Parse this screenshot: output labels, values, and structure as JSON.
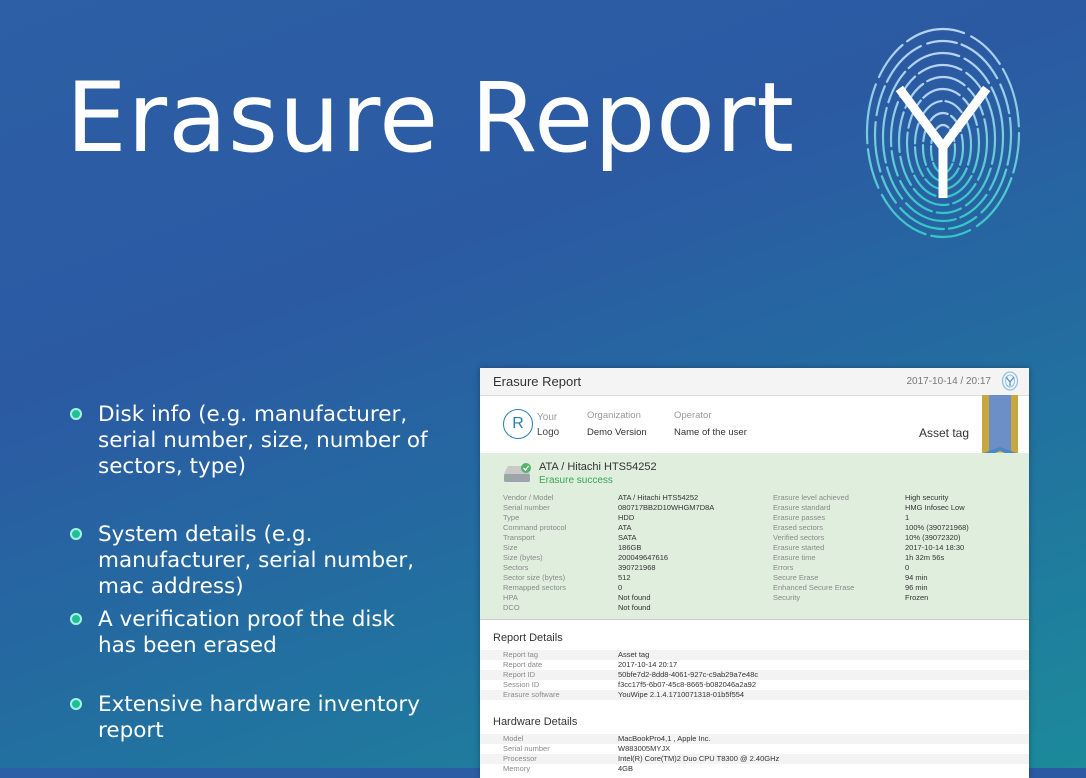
{
  "title": "Erasure Report",
  "bullets": [
    "Disk info (e.g. manufacturer, serial number, size, number of sectors, type)",
    "System details (e.g. manufacturer, serial number, mac address)",
    "A verification proof the disk has been erased",
    "Extensive hardware inventory report"
  ],
  "report": {
    "header_title": "Erasure Report",
    "header_date": "2017-10-14 / 20:17",
    "logo_letter": "R",
    "logo_line1": "Your",
    "logo_line2": "Logo",
    "org_label": "Organization",
    "org_value": "Demo Version",
    "operator_label": "Operator",
    "operator_value": "Name of the user",
    "asset_tag": "Asset tag",
    "disk_name": "ATA / Hitachi HTS54252",
    "disk_status": "Erasure success",
    "disk_left": [
      [
        "Vendor / Model",
        "ATA / Hitachi HTS54252"
      ],
      [
        "Serial number",
        "080717BB2D10WHGM7D8A"
      ],
      [
        "Type",
        "HDD"
      ],
      [
        "Command protocol",
        "ATA"
      ],
      [
        "Transport",
        "SATA"
      ],
      [
        "Size",
        "186GB"
      ],
      [
        "Size (bytes)",
        "200049647616"
      ],
      [
        "Sectors",
        "390721968"
      ],
      [
        "Sector size (bytes)",
        "512"
      ],
      [
        "Remapped sectors",
        "0"
      ],
      [
        "HPA",
        "Not found"
      ],
      [
        "DCO",
        "Not found"
      ]
    ],
    "disk_right": [
      [
        "Erasure level achieved",
        "High security"
      ],
      [
        "Erasure standard",
        "HMG Infosec Low"
      ],
      [
        "Erasure passes",
        "1"
      ],
      [
        "Erased sectors",
        "100% (390721968)"
      ],
      [
        "Verified sectors",
        "10% (39072320)"
      ],
      [
        "Erasure started",
        "2017-10-14 18:30"
      ],
      [
        "Erasure time",
        "1h 32m 56s"
      ],
      [
        "Errors",
        "0"
      ],
      [
        "Secure Erase",
        "94 min"
      ],
      [
        "Enhanced Secure Erase",
        "96 min"
      ],
      [
        "Security",
        "Frozen"
      ]
    ],
    "report_details_title": "Report Details",
    "report_details": [
      [
        "Report tag",
        "Asset tag"
      ],
      [
        "Report date",
        "2017-10-14 20:17"
      ],
      [
        "Report ID",
        "50bfe7d2-8dd8-4061-927c-c9ab29a7e48c"
      ],
      [
        "Session ID",
        "f3cc17f5-6b07-45c8-8665-b082046a2a92"
      ],
      [
        "Erasure software",
        "YouWipe 2.1.4.1710071318-01b5f554"
      ]
    ],
    "hardware_details_title": "Hardware Details",
    "hardware_details": [
      [
        "Model",
        "MacBookPro4,1 , Apple Inc."
      ],
      [
        "Serial number",
        "W883005MYJX"
      ],
      [
        "Processor",
        "Intel(R) Core(TM)2 Duo CPU T8300 @ 2.40GHz"
      ],
      [
        "Memory",
        "4GB"
      ]
    ]
  }
}
